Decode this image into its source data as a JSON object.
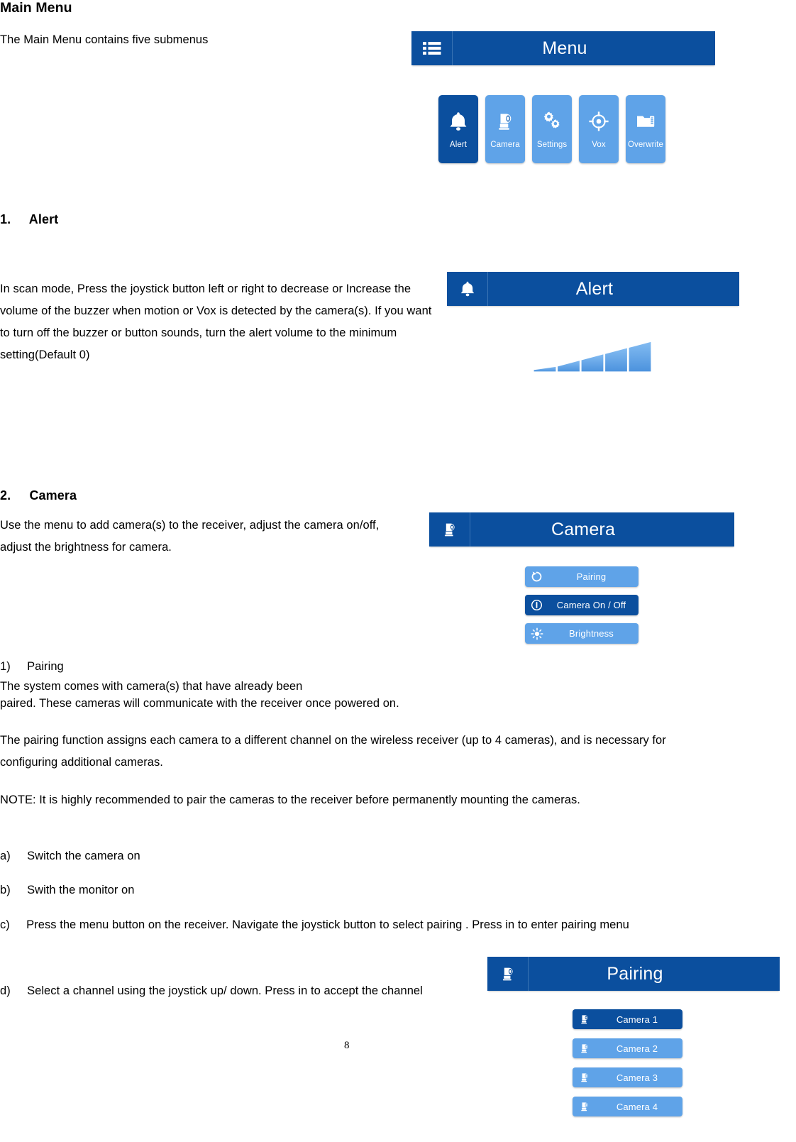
{
  "document": {
    "page_number": "8",
    "sections": [
      {
        "heading": "Main Menu",
        "intro": "The Main Menu contains five submenus"
      }
    ]
  },
  "section_main_menu": {
    "title": "Main Menu",
    "intro": "The Main Menu contains five submenus"
  },
  "section_alert": {
    "number": "1.",
    "title": "Alert",
    "body": "  In scan mode, Press the joystick button left or right to decrease or Increase the volume of the buzzer when motion or Vox is detected by the camera(s). If you want to turn off the buzzer or button sounds, turn the alert volume to the minimum setting(Default 0)"
  },
  "section_camera": {
    "number": "2.",
    "title": "Camera",
    "body": "Use the menu to add camera(s) to the receiver, adjust the camera on/off, adjust the brightness for camera.",
    "sub_number": "1)",
    "sub_title": "Pairing",
    "para1": "The system comes with camera(s) that have already been",
    "para2": "paired. These cameras will communicate with the receiver once powered on.",
    "para3": "The pairing function assigns each camera to a different channel on the wireless receiver (up to 4 cameras), and is necessary for configuring additional cameras.",
    "note": "NOTE: It is highly recommended to pair the cameras to the receiver before permanently mounting the cameras.",
    "steps": [
      {
        "marker": "a)",
        "text": "Switch the camera on"
      },
      {
        "marker": "b)",
        "text": " Swith the monitor on"
      },
      {
        "marker": "c)",
        "text": " Press the menu button on the receiver. Navigate the joystick button to select pairing . Press in to enter pairing menu"
      },
      {
        "marker": "d)",
        "text": "Select a channel using the joystick up/ down. Press in to accept the channel"
      }
    ]
  },
  "screen_menu": {
    "header_title": "Menu",
    "header_icon": "list-menu-icon",
    "tiles": [
      {
        "label": "Alert",
        "icon": "bell-icon",
        "selected": true
      },
      {
        "label": "Camera",
        "icon": "camera-icon",
        "selected": false
      },
      {
        "label": "Settings",
        "icon": "gears-icon",
        "selected": false
      },
      {
        "label": "Vox",
        "icon": "crosshair-icon",
        "selected": false
      },
      {
        "label": "Overwrite",
        "icon": "sdcard-folder-icon",
        "selected": false
      }
    ]
  },
  "screen_alert": {
    "header_title": "Alert",
    "header_icon": "bell-icon",
    "volume_segments": 5,
    "volume_label": "alert-volume-bar"
  },
  "screen_camera": {
    "header_title": "Camera",
    "header_icon": "camera-icon",
    "items": [
      {
        "label": "Pairing",
        "icon": "refresh-icon",
        "selected": false
      },
      {
        "label": "Camera On / Off",
        "icon": "power-info-icon",
        "selected": true
      },
      {
        "label": "Brightness",
        "icon": "brightness-icon",
        "selected": false
      }
    ]
  },
  "screen_pairing": {
    "header_title": "Pairing",
    "header_icon": "camera-icon",
    "items": [
      {
        "label": "Camera 1",
        "icon": "camera-icon",
        "selected": true
      },
      {
        "label": "Camera 2",
        "icon": "camera-icon",
        "selected": false
      },
      {
        "label": "Camera 3",
        "icon": "camera-icon",
        "selected": false
      },
      {
        "label": "Camera 4",
        "icon": "camera-icon",
        "selected": false
      }
    ]
  },
  "colors": {
    "header_blue": "#0b4f9e",
    "tile_light_blue": "#5fa3e8",
    "tile_selected_blue": "#0b4f9e",
    "text_black": "#000000",
    "page_background": "#ffffff"
  }
}
